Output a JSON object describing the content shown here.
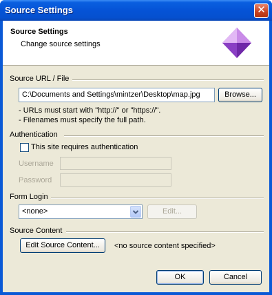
{
  "window": {
    "title": "Source Settings",
    "close_glyph": "✕"
  },
  "header": {
    "title": "Source Settings",
    "subtitle": "Change source settings",
    "icon": "diamond-gem-icon"
  },
  "source_url": {
    "section_label": "Source URL / File",
    "value": "C:\\Documents and Settings\\mintzer\\Desktop\\map.jpg",
    "browse_label": "Browse...",
    "note_1": "- URLs must start with \"http://\" or \"https://\".",
    "note_2": "- Filenames must specify the full path."
  },
  "authentication": {
    "section_label": "Authentication",
    "checkbox_label": "This site requires authentication",
    "checked": false,
    "username_label": "Username",
    "password_label": "Password"
  },
  "form_login": {
    "section_label": "Form Login",
    "selected": "<none>",
    "edit_label": "Edit..."
  },
  "source_content": {
    "section_label": "Source Content",
    "edit_button_label": "Edit Source Content...",
    "status": "<no source content specified>"
  },
  "footer": {
    "ok_label": "OK",
    "cancel_label": "Cancel"
  },
  "colors": {
    "titlebar": "#0553d6",
    "dialog_bg": "#ece9d8",
    "gem": "#b06ad8"
  }
}
